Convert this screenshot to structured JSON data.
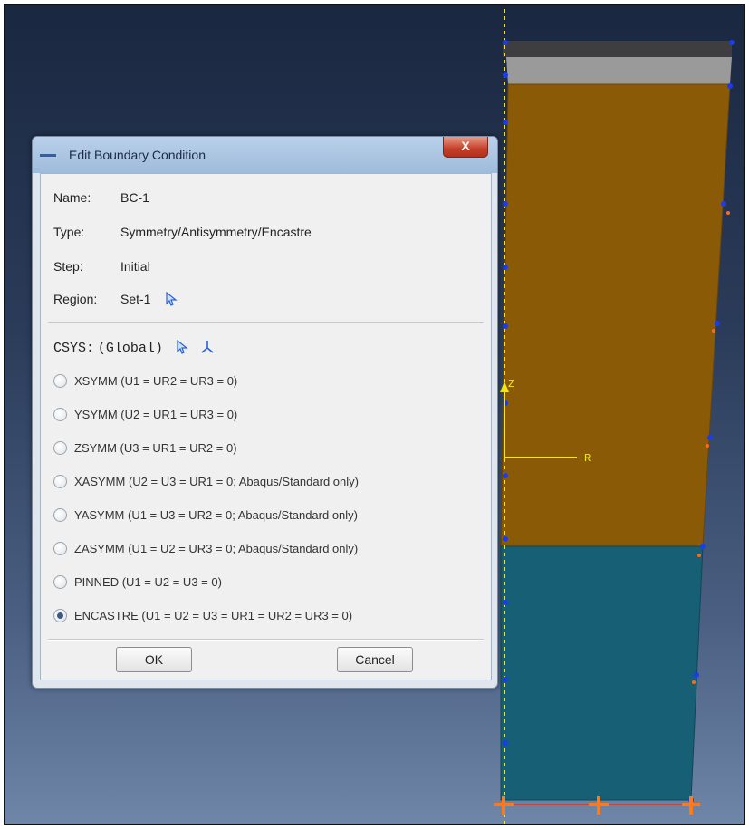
{
  "dialog": {
    "title": "Edit Boundary Condition",
    "close_label": "X",
    "name_label": "Name:",
    "name_value": "BC-1",
    "type_label": "Type:",
    "type_value": "Symmetry/Antisymmetry/Encastre",
    "step_label": "Step:",
    "step_value": "Initial",
    "region_label": "Region:",
    "region_value": "Set-1",
    "csys_label": "CSYS:",
    "csys_value": "(Global)",
    "options": [
      {
        "label": "XSYMM (U1 = UR2 = UR3 = 0)",
        "selected": false
      },
      {
        "label": "YSYMM (U2 = UR1 = UR3 = 0)",
        "selected": false
      },
      {
        "label": "ZSYMM (U3 = UR1 = UR2 = 0)",
        "selected": false
      },
      {
        "label": "XASYMM (U2 = U3 = UR1 = 0; Abaqus/Standard only)",
        "selected": false
      },
      {
        "label": "YASYMM (U1 = U3 = UR2 = 0; Abaqus/Standard only)",
        "selected": false
      },
      {
        "label": "ZASYMM (U1 = U2 = UR3 = 0; Abaqus/Standard only)",
        "selected": false
      },
      {
        "label": "PINNED (U1 = U2 = U3 = 0)",
        "selected": false
      },
      {
        "label": "ENCASTRE (U1 = U2 = U3 = UR1 = UR2 = UR3 = 0)",
        "selected": true
      }
    ],
    "ok_label": "OK",
    "cancel_label": "Cancel"
  },
  "viewport": {
    "axis_labels": {
      "z": "Z",
      "r": "R"
    },
    "colors": {
      "upper_part": "#8a5a06",
      "lower_part": "#165f74",
      "axis": "#f3e61a",
      "nodes": "#1a3cf0",
      "bc_marks": "#ff6a1a"
    }
  },
  "icons": {
    "region_select": "arrow-cursor-icon",
    "csys_select": "arrow-cursor-icon",
    "csys_create": "datum-csys-icon",
    "title": "window-menu-icon"
  }
}
